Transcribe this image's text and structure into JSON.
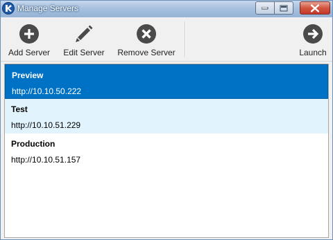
{
  "window": {
    "title": "Manage Servers"
  },
  "toolbar": {
    "add_label": "Add Server",
    "edit_label": "Edit Server",
    "remove_label": "Remove Server",
    "launch_label": "Launch"
  },
  "icons": {
    "add": "plus-circle",
    "edit": "pencil",
    "remove": "x-circle",
    "launch": "arrow-right-circle"
  },
  "servers": [
    {
      "name": "Preview",
      "url": "http://10.10.50.222",
      "state": "selected"
    },
    {
      "name": "Test",
      "url": "http://10.10.51.229",
      "state": "hover"
    },
    {
      "name": "Production",
      "url": "http://10.10.51.157",
      "state": "normal"
    }
  ],
  "colors": {
    "selection": "#0072c6",
    "hover": "#e1f3fd",
    "icon": "#4a4a4a",
    "close_button": "#c4392a"
  }
}
